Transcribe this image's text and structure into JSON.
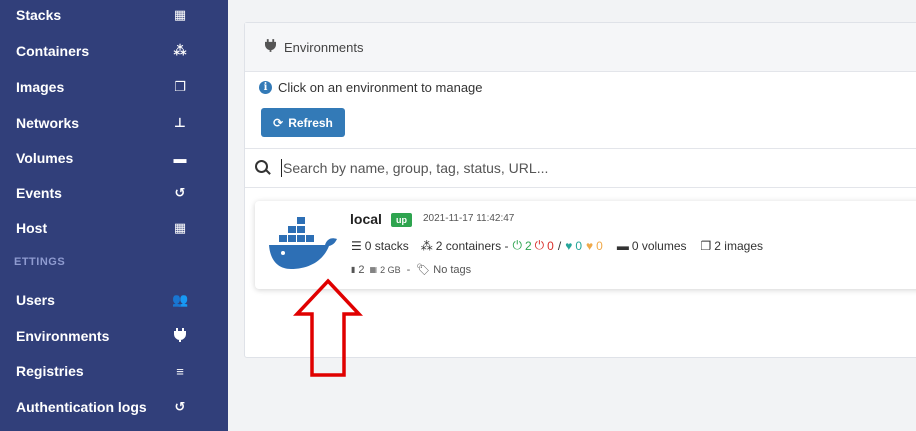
{
  "sidebar": {
    "items": [
      {
        "label": "Stacks",
        "icon": "stacks-icon",
        "glyph": "▦"
      },
      {
        "label": "Containers",
        "icon": "cubes-icon",
        "glyph": "⁂"
      },
      {
        "label": "Images",
        "icon": "clone-icon",
        "glyph": "❐"
      },
      {
        "label": "Networks",
        "icon": "sitemap-icon",
        "glyph": "⊥"
      },
      {
        "label": "Volumes",
        "icon": "hdd-icon",
        "glyph": "▬"
      },
      {
        "label": "Events",
        "icon": "history-icon",
        "glyph": "↺"
      },
      {
        "label": "Host",
        "icon": "grid-icon",
        "glyph": "▦"
      }
    ],
    "section_label": "ETTINGS",
    "settings_items": [
      {
        "label": "Users",
        "icon": "users-icon",
        "glyph": "👥"
      },
      {
        "label": "Environments",
        "icon": "plug-icon",
        "glyph": "🜁"
      },
      {
        "label": "Registries",
        "icon": "database-icon",
        "glyph": "≡"
      },
      {
        "label": "Authentication logs",
        "icon": "history-icon",
        "glyph": "↺"
      }
    ]
  },
  "panel": {
    "title": "Environments",
    "info_text": "Click on an environment to manage",
    "refresh_label": "Refresh",
    "search_placeholder": "Search by name, group, tag, status, URL..."
  },
  "environment": {
    "name": "local",
    "status": "up",
    "timestamp": "2021-11-17 11:42:47",
    "stacks": "0 stacks",
    "containers": "2 containers -",
    "running": "2",
    "stopped": "0",
    "separator": "/",
    "healthy": "0",
    "unhealthy": "0",
    "volumes": "0 volumes",
    "images": "2 images",
    "cpu": "2",
    "memory": "2 GB",
    "meta_sep": "-",
    "tags": "No tags"
  },
  "colors": {
    "sidebar": "#313f7a",
    "primary": "#337ab7",
    "status_up": "#2ea44f",
    "arrow": "#e00000"
  }
}
